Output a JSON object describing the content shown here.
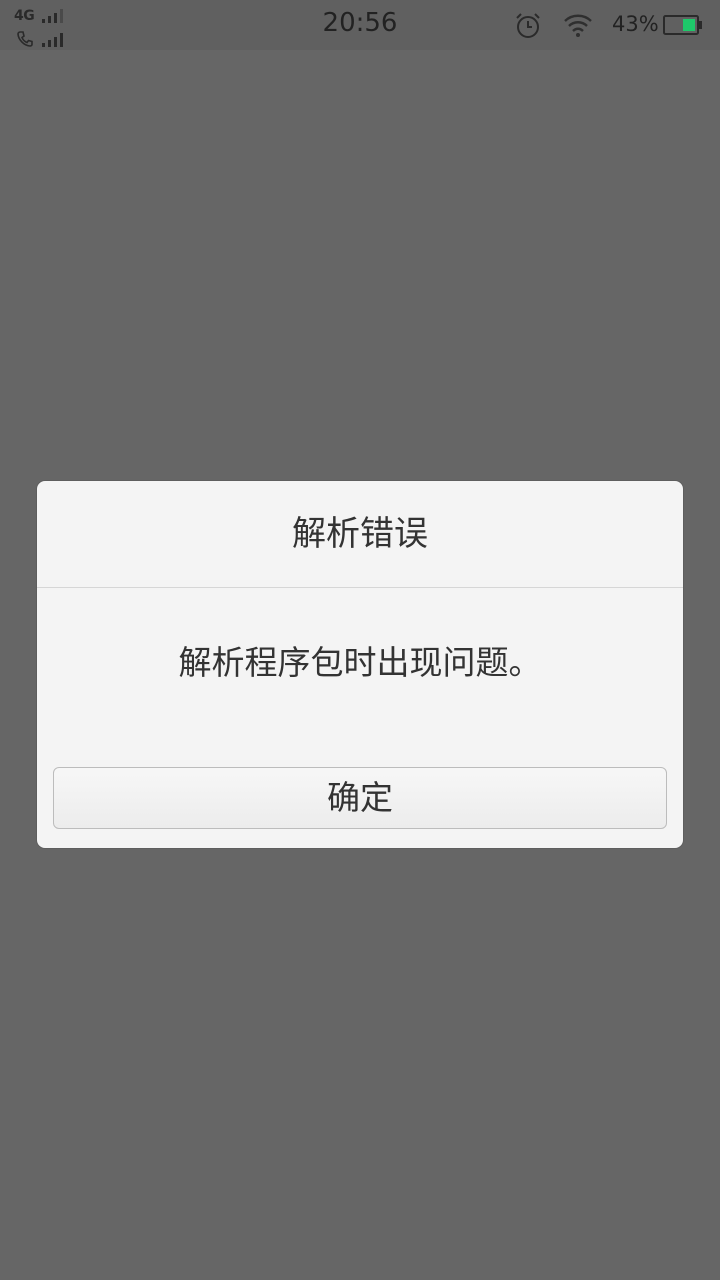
{
  "status_bar": {
    "network": "4G",
    "time": "20:56",
    "battery_percent": "43%",
    "battery_level": 0.43,
    "battery_color": "#1ec86a",
    "icons": [
      "signal-icon",
      "phone-icon",
      "alarm-icon",
      "wifi-icon",
      "battery-icon"
    ]
  },
  "dialog": {
    "title": "解析错误",
    "message": "解析程序包时出现问题。",
    "ok_label": "确定"
  },
  "colors": {
    "overlay": "#666666",
    "dialog_bg": "#f4f4f4",
    "text": "#333333"
  }
}
